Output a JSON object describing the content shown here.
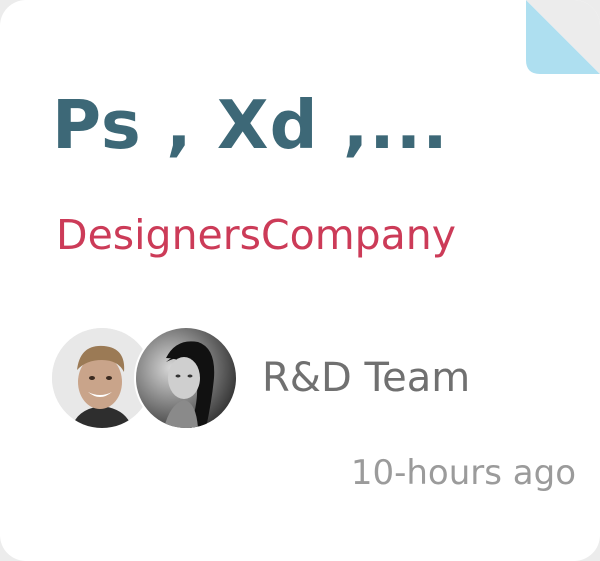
{
  "card": {
    "title": "Ps , Xd ,...",
    "company": "DesignersCompany",
    "team": {
      "label": "R&D Team",
      "members": [
        "avatar-man",
        "avatar-woman"
      ]
    },
    "timestamp": "10-hours ago"
  },
  "colors": {
    "background": "#ececec",
    "card": "#ffffff",
    "title": "#3d6877",
    "company": "#cc3b58",
    "team_label": "#707070",
    "timestamp": "#9b9b9b",
    "fold": "#aedff0"
  },
  "icons": {
    "corner": "page-fold-icon"
  }
}
